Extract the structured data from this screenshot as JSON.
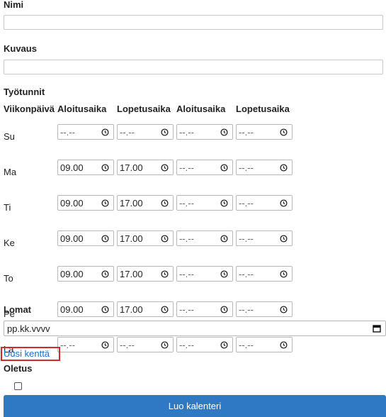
{
  "form": {
    "name_label": "Nimi",
    "name_value": "",
    "description_label": "Kuvaus",
    "description_value": "",
    "hours_label": "Työtunnit",
    "columns": [
      "Viikonpäivä",
      "Aloitusaika",
      "Lopetusaika",
      "Aloitusaika",
      "Lopetusaika"
    ],
    "days": [
      {
        "day": "Su",
        "times": [
          "--.--",
          "--.--",
          "--.--",
          "--.--"
        ]
      },
      {
        "day": "Ma",
        "times": [
          "09.00",
          "17.00",
          "--.--",
          "--.--"
        ]
      },
      {
        "day": "Ti",
        "times": [
          "09.00",
          "17.00",
          "--.--",
          "--.--"
        ]
      },
      {
        "day": "Ke",
        "times": [
          "09.00",
          "17.00",
          "--.--",
          "--.--"
        ]
      },
      {
        "day": "To",
        "times": [
          "09.00",
          "17.00",
          "--.--",
          "--.--"
        ]
      },
      {
        "day": "Pe",
        "times": [
          "09.00",
          "17.00",
          "--.--",
          "--.--"
        ]
      },
      {
        "day": "La",
        "times": [
          "--.--",
          "--.--",
          "--.--",
          "--.--"
        ]
      }
    ],
    "holidays_label": "Lomat",
    "holiday_date_placeholder": "pp.kk.vvvv",
    "new_field_link": "Uusi kenttä",
    "default_label": "Oletus",
    "default_checked": false,
    "submit_label": "Luo kalenteri"
  },
  "icons": {
    "time_icon": "clock-icon",
    "date_icon": "calendar-icon"
  },
  "colors": {
    "button": "#2f78c3",
    "link": "#1a6fc8",
    "highlight": "#d12a2a"
  }
}
